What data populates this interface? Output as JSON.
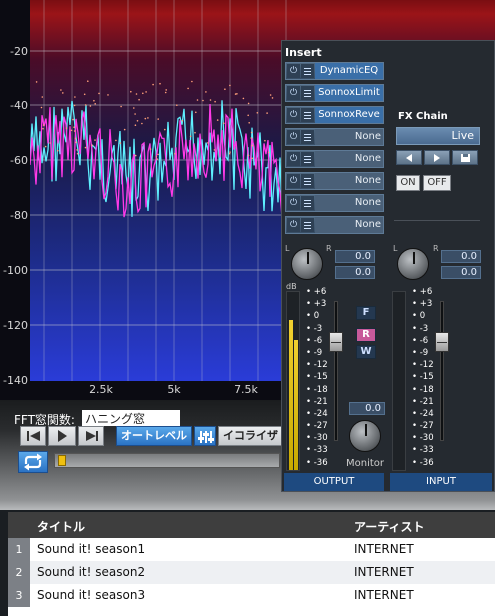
{
  "spectrum": {
    "y_axis_labels": [
      "-20",
      "-40",
      "-60",
      "-80",
      "-100",
      "-120",
      "-140"
    ],
    "x_axis_labels": [
      "2.5k",
      "5k",
      "7.5k"
    ]
  },
  "controls": {
    "fft_window_label": "FFT窓関数:",
    "fft_window_value": "ハニング窓",
    "autolevel_label": "オートレベル",
    "equalizer_label": "イコライザ"
  },
  "playlist": {
    "columns": [
      "タイトル",
      "アーティスト"
    ],
    "rows": [
      {
        "num": "1",
        "title": "Sound it! season1",
        "artist": "INTERNET"
      },
      {
        "num": "2",
        "title": "Sound it! season2",
        "artist": "INTERNET"
      },
      {
        "num": "3",
        "title": "Sound it! season3",
        "artist": "INTERNET"
      }
    ]
  },
  "mixer": {
    "insert_title": "Insert",
    "slots": [
      "DynamicEQ",
      "SonnoxLimit",
      "SonnoxReve",
      "None",
      "None",
      "None",
      "None",
      "None"
    ],
    "power_icon": "power-icon",
    "menu_icon": "menu-icon",
    "fx_chain": {
      "title": "FX Chain",
      "preset": "Live",
      "on_label": "ON",
      "off_label": "OFF"
    },
    "output": {
      "pan_l": "L",
      "pan_r": "R",
      "value_1": "0.0",
      "value_2": "0.0",
      "db_label": "dB",
      "label": "OUTPUT"
    },
    "input": {
      "pan_l": "L",
      "pan_r": "R",
      "value_1": "0.0",
      "value_2": "0.0",
      "label": "INPUT"
    },
    "scale": [
      "+6",
      "+3",
      "0",
      "-3",
      "-6",
      "-9",
      "-12",
      "-15",
      "-18",
      "-21",
      "-24",
      "-27",
      "-30",
      "-33",
      "-36"
    ],
    "buttons": {
      "f": "F",
      "r": "R",
      "w": "W"
    },
    "monitor": {
      "value": "0.0",
      "label": "Monitor"
    }
  }
}
